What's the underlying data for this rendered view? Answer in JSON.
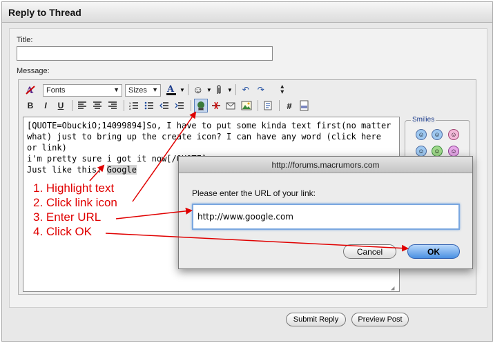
{
  "panel": {
    "title": "Reply to Thread"
  },
  "form": {
    "title_label": "Title:",
    "title_value": "",
    "message_label": "Message:"
  },
  "toolbar": {
    "font_select": "Fonts",
    "size_select": "Sizes",
    "bold": "B",
    "italic": "I",
    "underline": "U",
    "code": "#",
    "row1_icons": [
      "remove-formatting-icon",
      "font-color-icon",
      "smiley-menu-icon",
      "attachment-icon",
      "undo-icon",
      "redo-icon",
      "resize-icon"
    ],
    "row2_icons": [
      "bold-icon",
      "italic-icon",
      "underline-icon",
      "align-left-icon",
      "align-center-icon",
      "align-right-icon",
      "ordered-list-icon",
      "unordered-list-icon",
      "outdent-icon",
      "indent-icon",
      "insert-link-icon",
      "remove-link-icon",
      "email-link-icon",
      "insert-image-icon",
      "quote-icon",
      "code-icon",
      "php-icon"
    ]
  },
  "editor": {
    "lines": [
      "[QUOTE=ObuckiO;14099894]So, I have to put some kinda text first(no matter",
      "what) just to bring up the create icon? I can have any word (click here or link)",
      "i'm pretty sure i got it now[/QUOTE]"
    ],
    "last_line_prefix": "Just like this: ",
    "highlighted_word": "Google"
  },
  "smilies": {
    "legend": "Smilies"
  },
  "annotations": {
    "steps": [
      "1. Highlight text",
      "2. Click link icon",
      "3. Enter URL",
      "4. Click OK"
    ],
    "arrow_color": "#e00000"
  },
  "dialog": {
    "title": "http://forums.macrumors.com",
    "prompt": "Please enter the URL of your link:",
    "url_value": "http://www.google.com",
    "cancel_label": "Cancel",
    "ok_label": "OK"
  },
  "footer": {
    "submit_label": "Submit Reply",
    "preview_label": "Preview Post"
  }
}
